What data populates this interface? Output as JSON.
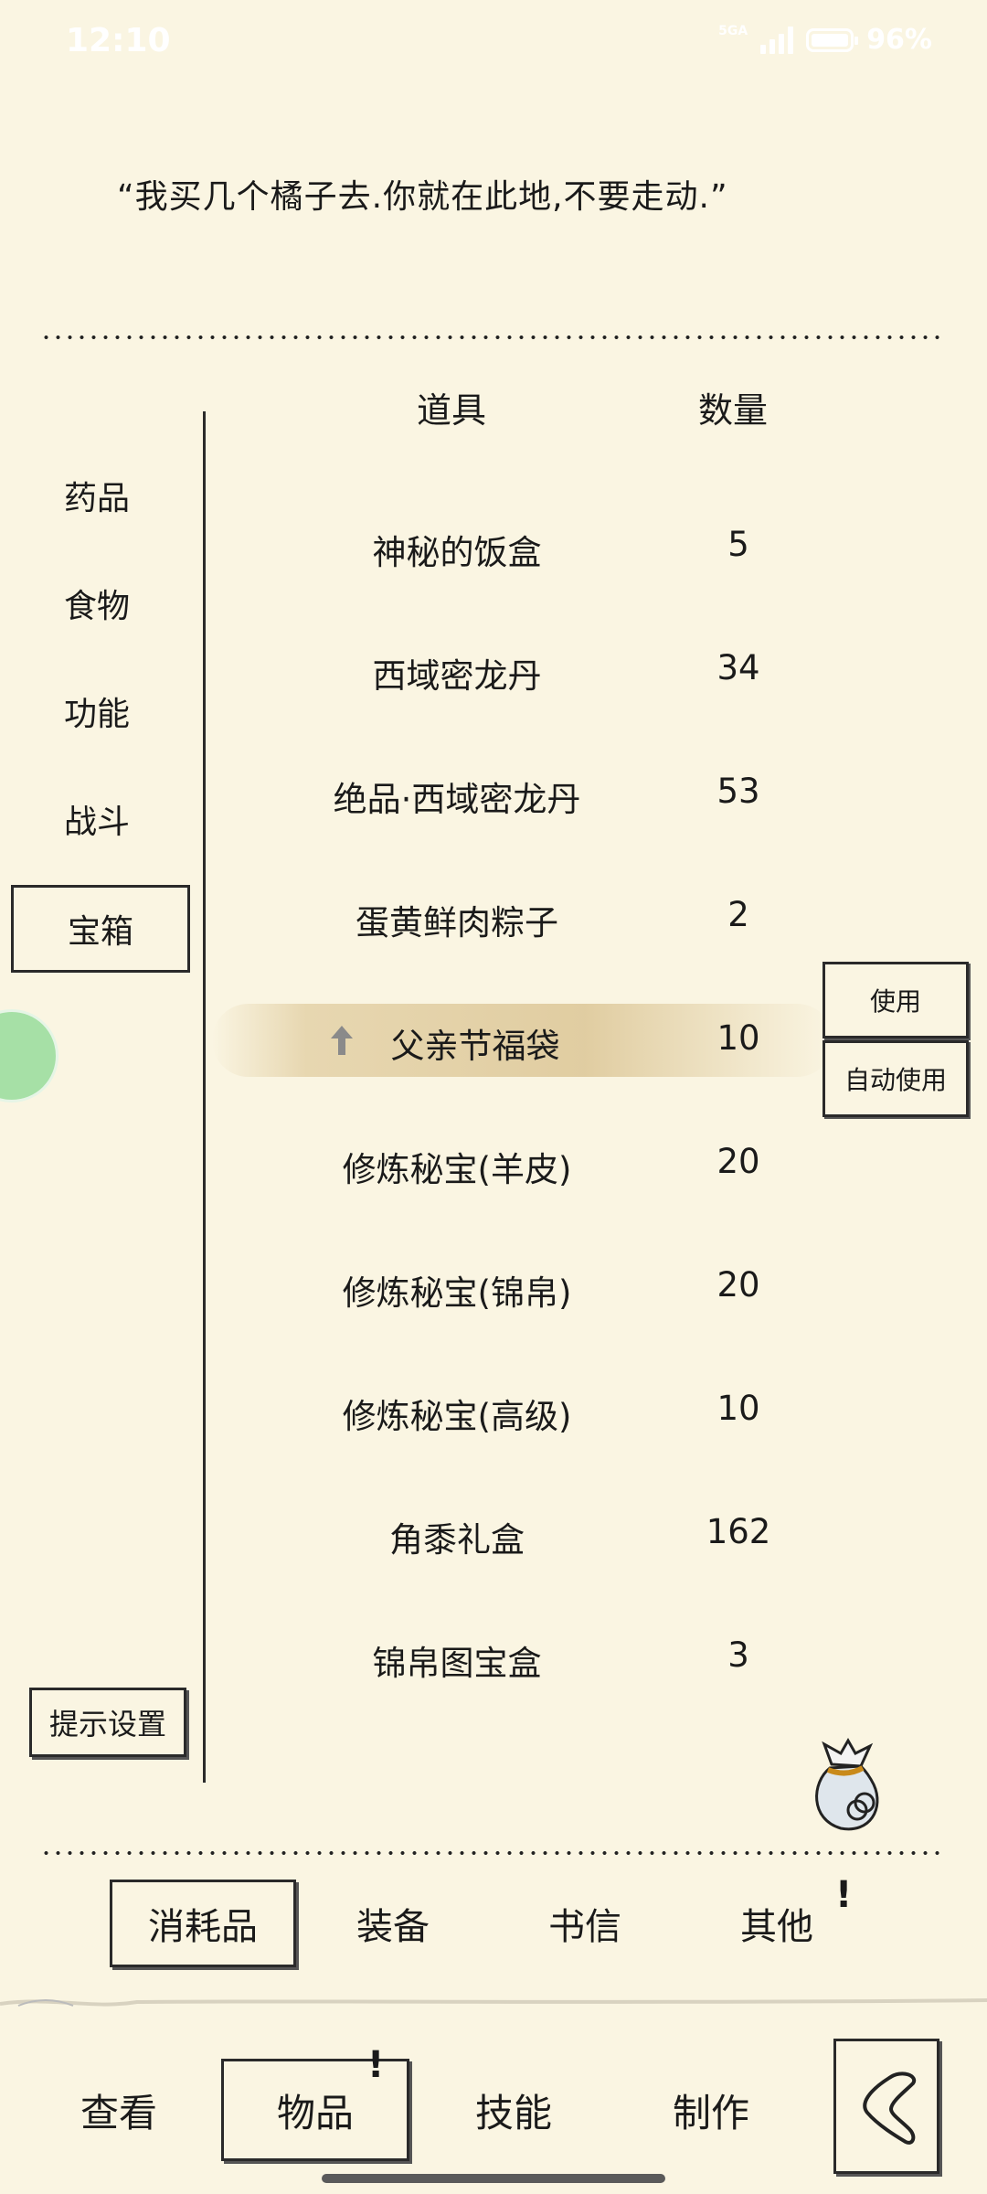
{
  "status_bar": {
    "time": "12:10",
    "network": "5GA",
    "battery": "96%"
  },
  "quote": "“我买几个橘子去.你就在此地,不要走动.”",
  "side_categories": [
    {
      "label": "药品",
      "selected": false
    },
    {
      "label": "食物",
      "selected": false
    },
    {
      "label": "功能",
      "selected": false
    },
    {
      "label": "战斗",
      "selected": false
    },
    {
      "label": "宝箱",
      "selected": true
    }
  ],
  "hint_button": "提示设置",
  "table": {
    "header_item": "道具",
    "header_qty": "数量",
    "rows": [
      {
        "name": "神秘的饭盒",
        "qty": "5"
      },
      {
        "name": "西域密龙丹",
        "qty": "34"
      },
      {
        "name": "绝品·西域密龙丹",
        "qty": "53"
      },
      {
        "name": "蛋黄鲜肉粽子",
        "qty": "2"
      },
      {
        "name": "父亲节福袋",
        "qty": "10",
        "selected": true
      },
      {
        "name": "修炼秘宝(羊皮)",
        "qty": "20"
      },
      {
        "name": "修炼秘宝(锦帛)",
        "qty": "20"
      },
      {
        "name": "修炼秘宝(高级)",
        "qty": "10"
      },
      {
        "name": "角黍礼盒",
        "qty": "162"
      },
      {
        "name": "锦帛图宝盒",
        "qty": "3"
      }
    ]
  },
  "actions": {
    "use": "使用",
    "auto_use": "自动使用"
  },
  "sub_tabs": [
    {
      "label": "消耗品",
      "selected": true
    },
    {
      "label": "装备",
      "selected": false
    },
    {
      "label": "书信",
      "selected": false
    },
    {
      "label": "其他",
      "selected": false,
      "alert": "!"
    }
  ],
  "nav_tabs": [
    {
      "label": "查看",
      "selected": false
    },
    {
      "label": "物品",
      "selected": true,
      "alert": "!"
    },
    {
      "label": "技能",
      "selected": false
    },
    {
      "label": "制作",
      "selected": false
    }
  ],
  "icons": {
    "back": "back-chevron-icon",
    "bag": "item-bag-icon",
    "up": "up-arrow-icon"
  },
  "colors": {
    "background": "#faf5e2",
    "ink": "#1a1a1a",
    "highlight": "#dcc696",
    "green_bubble": "#a6e0a6"
  }
}
